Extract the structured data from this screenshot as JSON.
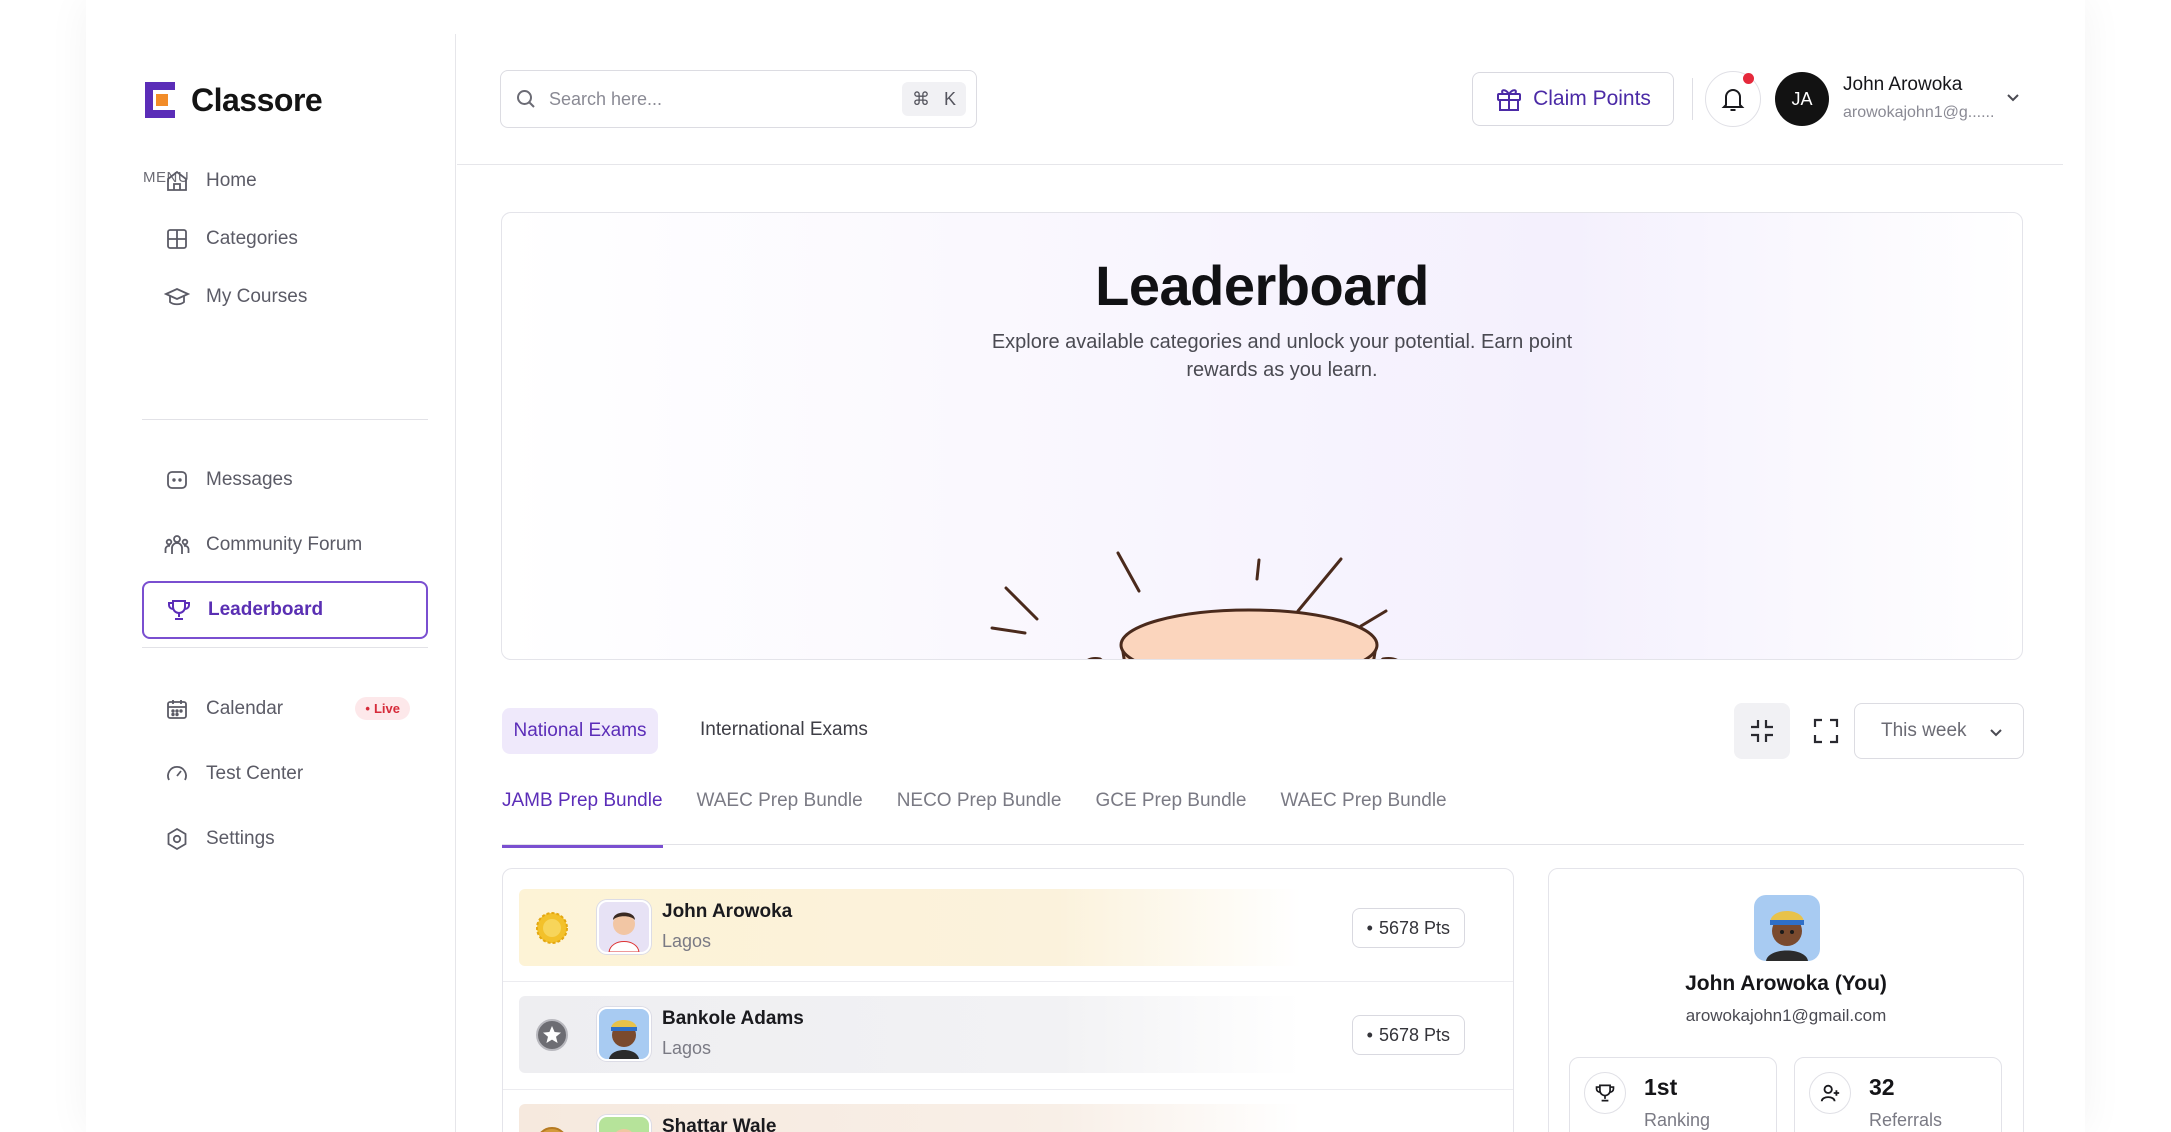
{
  "brand": {
    "name": "Classore",
    "accent": "#5b2db8"
  },
  "sidebar": {
    "menu_label": "MENU",
    "items": [
      {
        "label": "Home",
        "icon": "home-icon"
      },
      {
        "label": "Categories",
        "icon": "grid-icon"
      },
      {
        "label": "My Courses",
        "icon": "graduation-cap-icon"
      },
      {
        "label": "Messages",
        "icon": "message-icon"
      },
      {
        "label": "Community Forum",
        "icon": "community-icon"
      },
      {
        "label": "Leaderboard",
        "icon": "trophy-icon",
        "active": true
      },
      {
        "label": "Calendar",
        "icon": "calendar-icon",
        "badge": "Live"
      },
      {
        "label": "Test Center",
        "icon": "gauge-icon"
      },
      {
        "label": "Settings",
        "icon": "settings-icon"
      }
    ]
  },
  "header": {
    "search_placeholder": "Search here...",
    "shortcut_symbol": "⌘",
    "shortcut_key": "K",
    "claim_label": "Claim Points",
    "user": {
      "initials": "JA",
      "name": "John Arowoka",
      "email": "arowokajohn1@g......"
    }
  },
  "hero": {
    "title": "Leaderboard",
    "subtitle": "Explore available categories and unlock your potential. Earn point rewards as you learn."
  },
  "tabs": {
    "primary": [
      "National Exams",
      "International Exams"
    ],
    "period": "This week",
    "secondary": [
      "JAMB Prep Bundle",
      "WAEC Prep Bundle",
      "NECO Prep Bundle",
      "GCE Prep Bundle",
      "WAEC Prep Bundle"
    ]
  },
  "leaderboard": [
    {
      "name": "John Arowoka",
      "city": "Lagos",
      "points": "5678 Pts",
      "medal": "gold"
    },
    {
      "name": "Bankole Adams",
      "city": "Lagos",
      "points": "5678 Pts",
      "medal": "silver"
    },
    {
      "name": "Shattar Wale",
      "city": "",
      "points": "",
      "medal": "bronze"
    }
  ],
  "profile": {
    "name": "John Arowoka (You)",
    "email": "arowokajohn1@gmail.com",
    "ranking_value": "1st",
    "ranking_label": "Ranking",
    "referrals_value": "32",
    "referrals_label": "Referrals"
  }
}
